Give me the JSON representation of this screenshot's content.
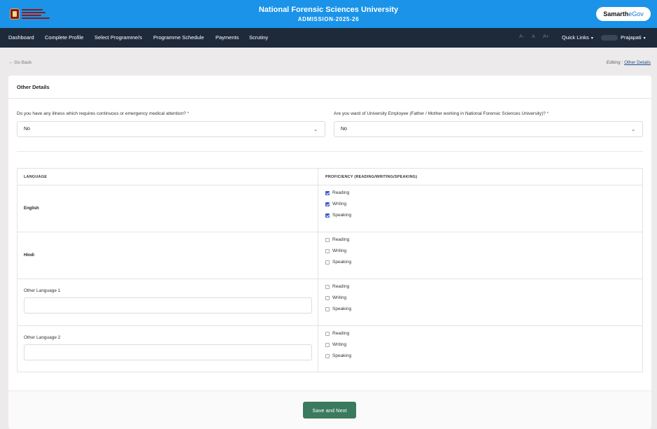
{
  "header": {
    "university": "National Forensic Sciences University",
    "admission": "ADMISSION-2025-26",
    "brand_main": "Samarth",
    "brand_sub": "eGov"
  },
  "nav": {
    "items": [
      "Dashboard",
      "Complete Profile",
      "Select Programme/s",
      "Programme Schedule",
      "Payments",
      "Scrutiny"
    ],
    "font_sizes": [
      "A-",
      "A",
      "A+"
    ],
    "quick_links": "Quick Links",
    "user_name": "Prajapati"
  },
  "page": {
    "back": "← Go Back",
    "editing_prefix": "Editing :",
    "editing_link": "Other Details"
  },
  "form": {
    "title": "Other Details",
    "q1": {
      "label": "Do you have any illness which requires continuous or emergency medical attention?",
      "value": "No"
    },
    "q2": {
      "label": "Are you ward of University Employee (Father / Mother working in National Forensic Sciences University)?",
      "value": "No"
    },
    "required_mark": "*"
  },
  "table": {
    "col_language": "LANGUAGE",
    "col_proficiency": "PROFICIENCY (READING/WRITING/SPEAKING)",
    "skills": [
      "Reading",
      "Writing",
      "Speaking"
    ],
    "rows": [
      {
        "language": "English",
        "type": "fixed",
        "checked": [
          true,
          true,
          true
        ]
      },
      {
        "language": "Hindi",
        "type": "fixed",
        "checked": [
          false,
          false,
          false
        ]
      },
      {
        "language": "Other Language 1",
        "type": "input",
        "value": "",
        "checked": [
          false,
          false,
          false
        ]
      },
      {
        "language": "Other Language 2",
        "type": "input",
        "value": "",
        "checked": [
          false,
          false,
          false
        ]
      }
    ]
  },
  "actions": {
    "save": "Save and Next"
  },
  "colors": {
    "topbar": "#1a93e8",
    "navbar": "#1e2a3a",
    "save_button": "#3a7a5d",
    "checkbox": "#3b5bc8"
  }
}
